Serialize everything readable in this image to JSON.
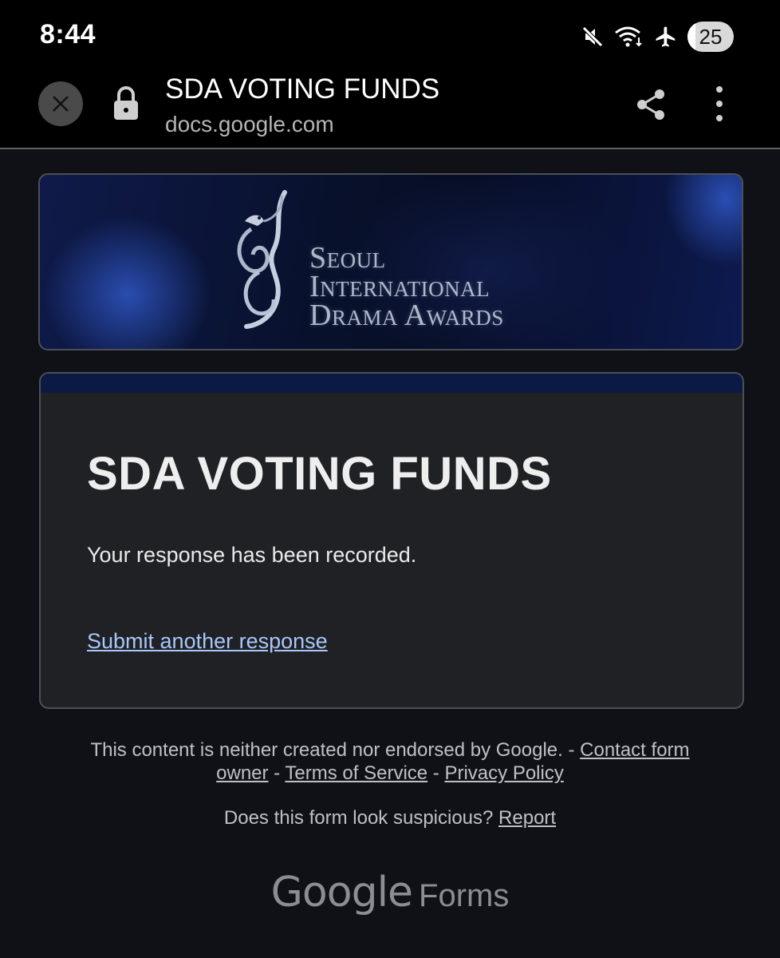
{
  "status_bar": {
    "time": "8:44",
    "battery": "25",
    "icons": [
      "mute-icon",
      "wifi-icon",
      "airplane-icon",
      "battery-icon"
    ]
  },
  "browser": {
    "title": "SDA VOTING FUNDS",
    "domain": "docs.google.com",
    "icons": [
      "close-icon",
      "lock-icon",
      "share-icon",
      "more-vert-icon"
    ]
  },
  "banner": {
    "line1": "Seoul",
    "line2": "International",
    "line3": "Drama Awards"
  },
  "card": {
    "title": "SDA VOTING FUNDS",
    "message": "Your response has been recorded.",
    "submit_another": "Submit another response",
    "accent_color": "#0b1a44"
  },
  "footer": {
    "disclaimer": "This content is neither created nor endorsed by Google.",
    "sep": " - ",
    "contact": "Contact form owner",
    "terms": "Terms of Service",
    "privacy": "Privacy Policy",
    "suspicious": "Does this form look suspicious?",
    "report": "Report",
    "logo_google": "Google",
    "logo_forms": "Forms"
  },
  "colors": {
    "background": "#0f1117",
    "card": "#202124",
    "link": "#a8c7fa"
  }
}
